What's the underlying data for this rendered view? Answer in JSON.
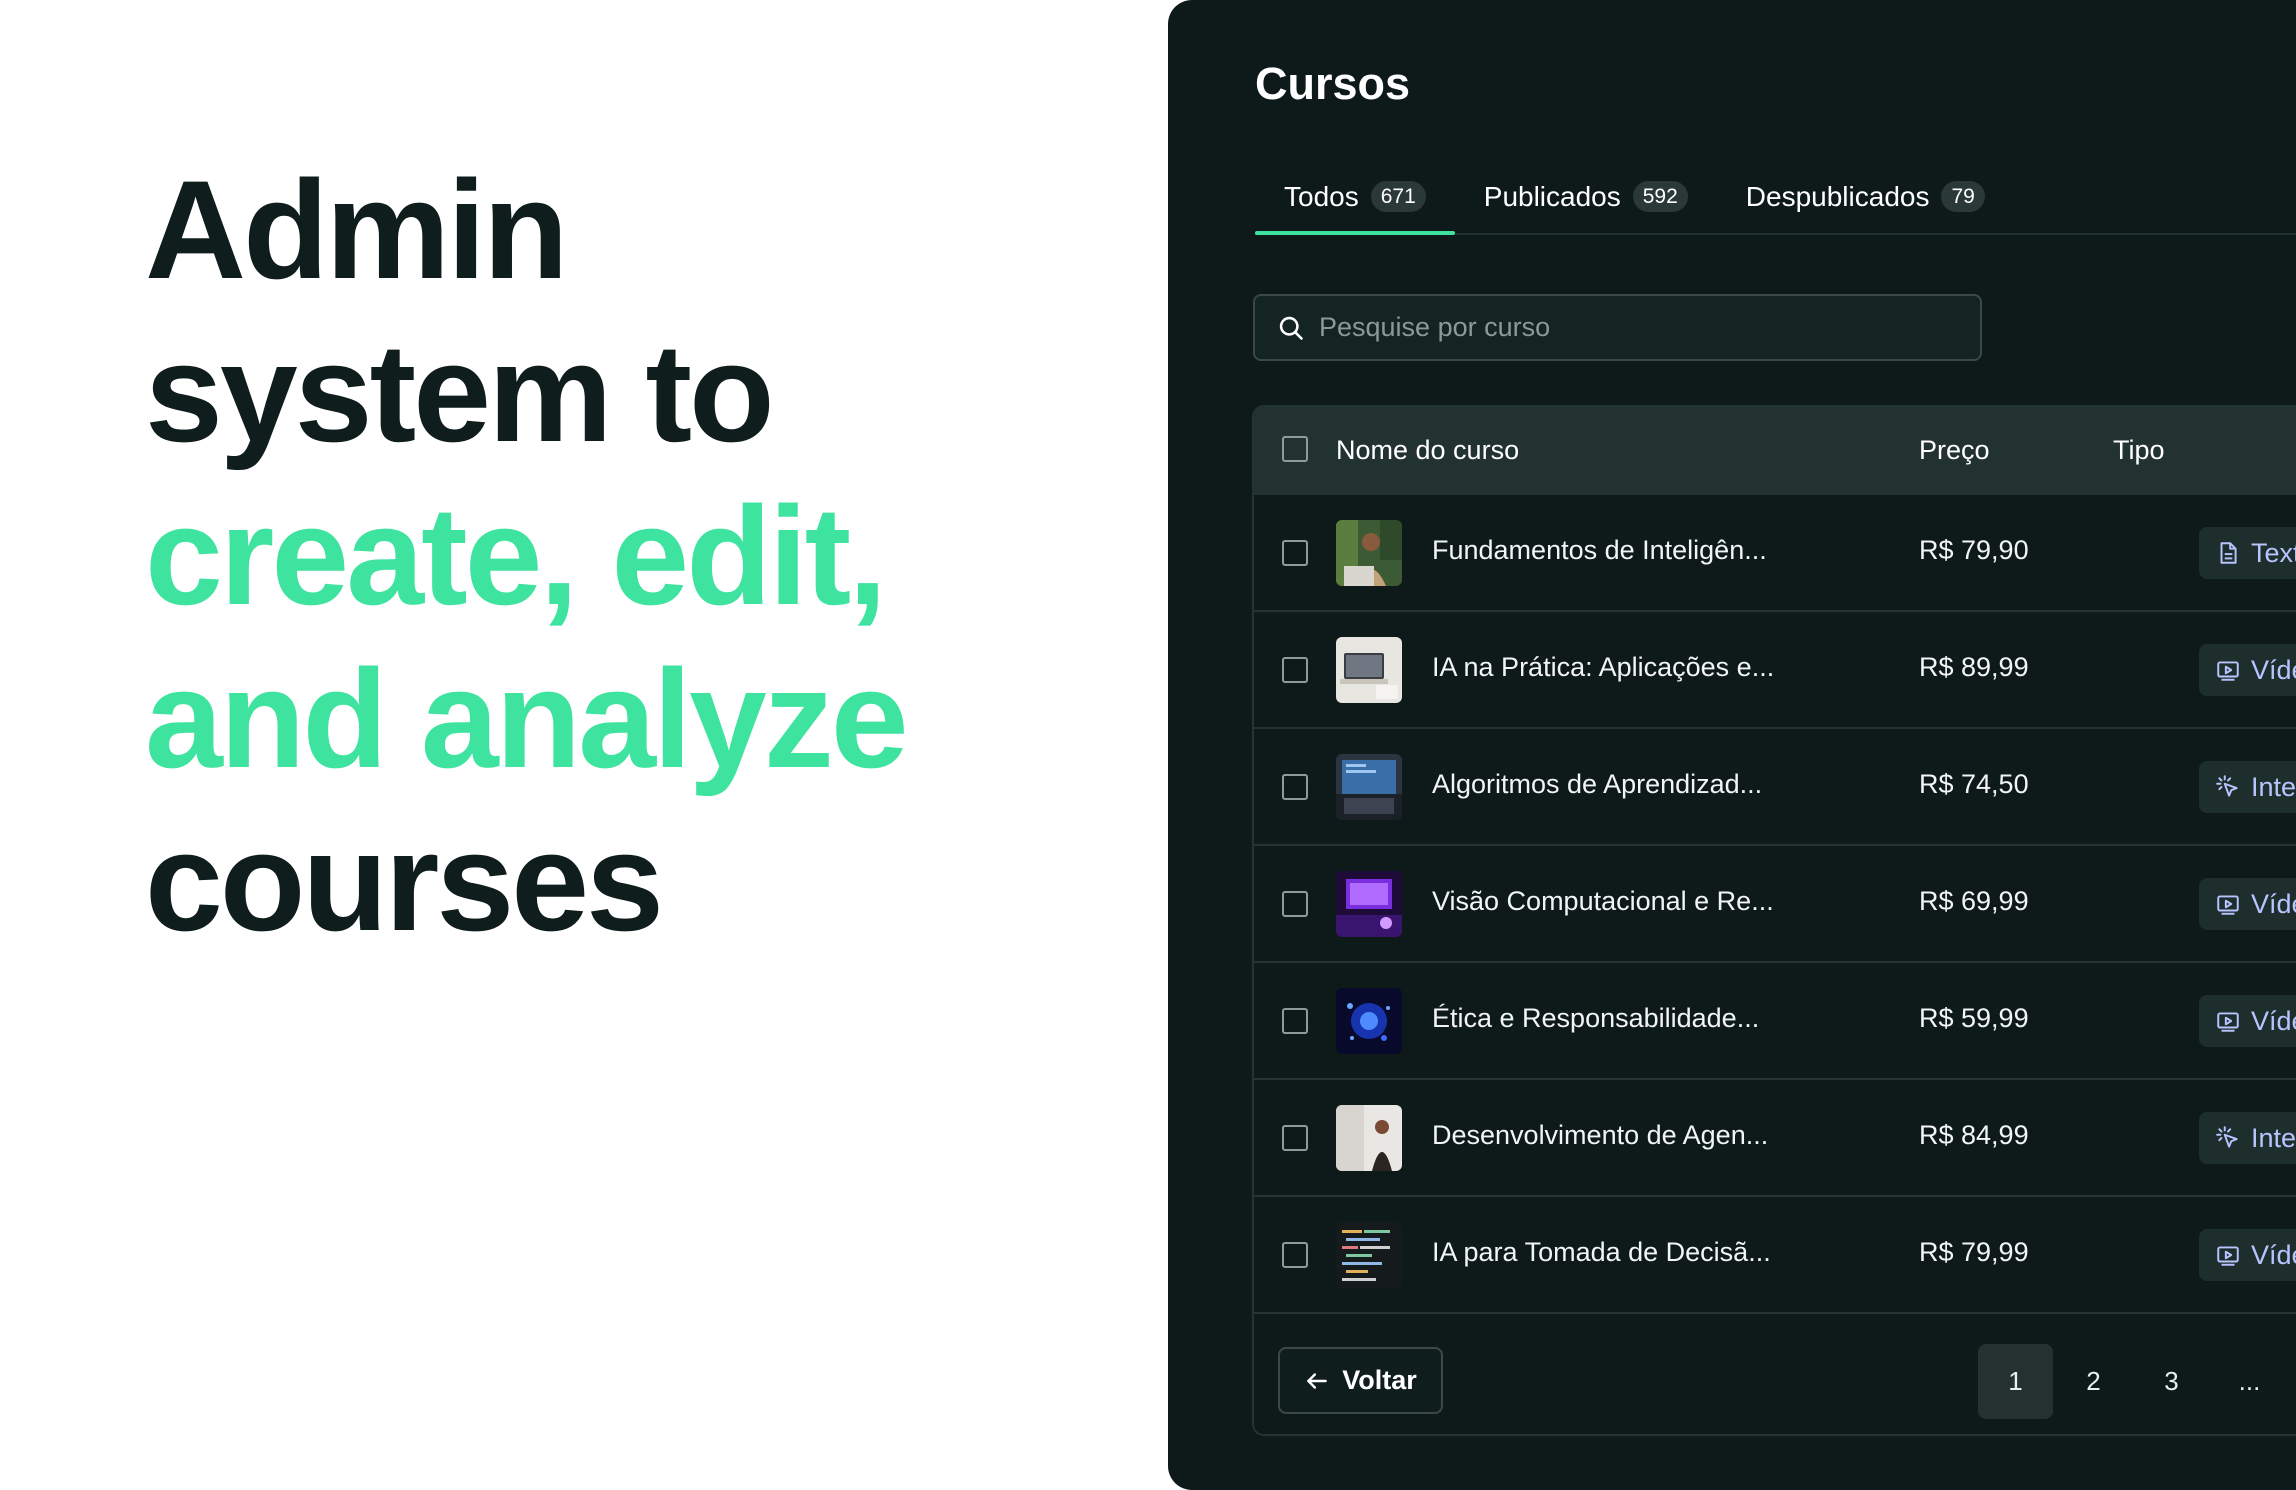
{
  "hero": {
    "line1": "Admin",
    "line2": "system to",
    "line3": "create, edit,",
    "line4": "and analyze",
    "line5": "courses"
  },
  "panel": {
    "title": "Cursos",
    "tabs": [
      {
        "label": "Todos",
        "count": "671",
        "active": true
      },
      {
        "label": "Publicados",
        "count": "592",
        "active": false
      },
      {
        "label": "Despublicados",
        "count": "79",
        "active": false
      }
    ],
    "search": {
      "placeholder": "Pesquise por curso",
      "value": ""
    },
    "table": {
      "headers": {
        "name": "Nome do curso",
        "price": "Preço",
        "type": "Tipo"
      },
      "rows": [
        {
          "name": "Fundamentos de Inteligên...",
          "price": "R$ 79,90",
          "type": "Texto",
          "type_icon": "document-icon"
        },
        {
          "name": "IA na Prática: Aplicações e...",
          "price": "R$ 89,99",
          "type": "Vídeo",
          "type_icon": "video-icon"
        },
        {
          "name": "Algoritmos de Aprendizad...",
          "price": "R$ 74,50",
          "type": "Interativo",
          "type_icon": "cursor-click-icon"
        },
        {
          "name": "Visão Computacional e Re...",
          "price": "R$ 69,99",
          "type": "Vídeo",
          "type_icon": "video-icon"
        },
        {
          "name": "Ética e Responsabilidade...",
          "price": "R$ 59,99",
          "type": "Vídeo",
          "type_icon": "video-icon"
        },
        {
          "name": "Desenvolvimento de Agen...",
          "price": "R$ 84,99",
          "type": "Interativo",
          "type_icon": "cursor-click-icon"
        },
        {
          "name": "IA para Tomada de Decisã...",
          "price": "R$ 79,99",
          "type": "Vídeo",
          "type_icon": "video-icon"
        }
      ]
    },
    "footer": {
      "back_label": "Voltar",
      "pages": [
        "1",
        "2",
        "3",
        "..."
      ],
      "current_page": "1"
    }
  },
  "colors": {
    "accent": "#3fe3a0",
    "panel_bg": "#0d1a19",
    "hero_text": "#0f1d1c",
    "type_badge_text": "#b9c4ff"
  }
}
